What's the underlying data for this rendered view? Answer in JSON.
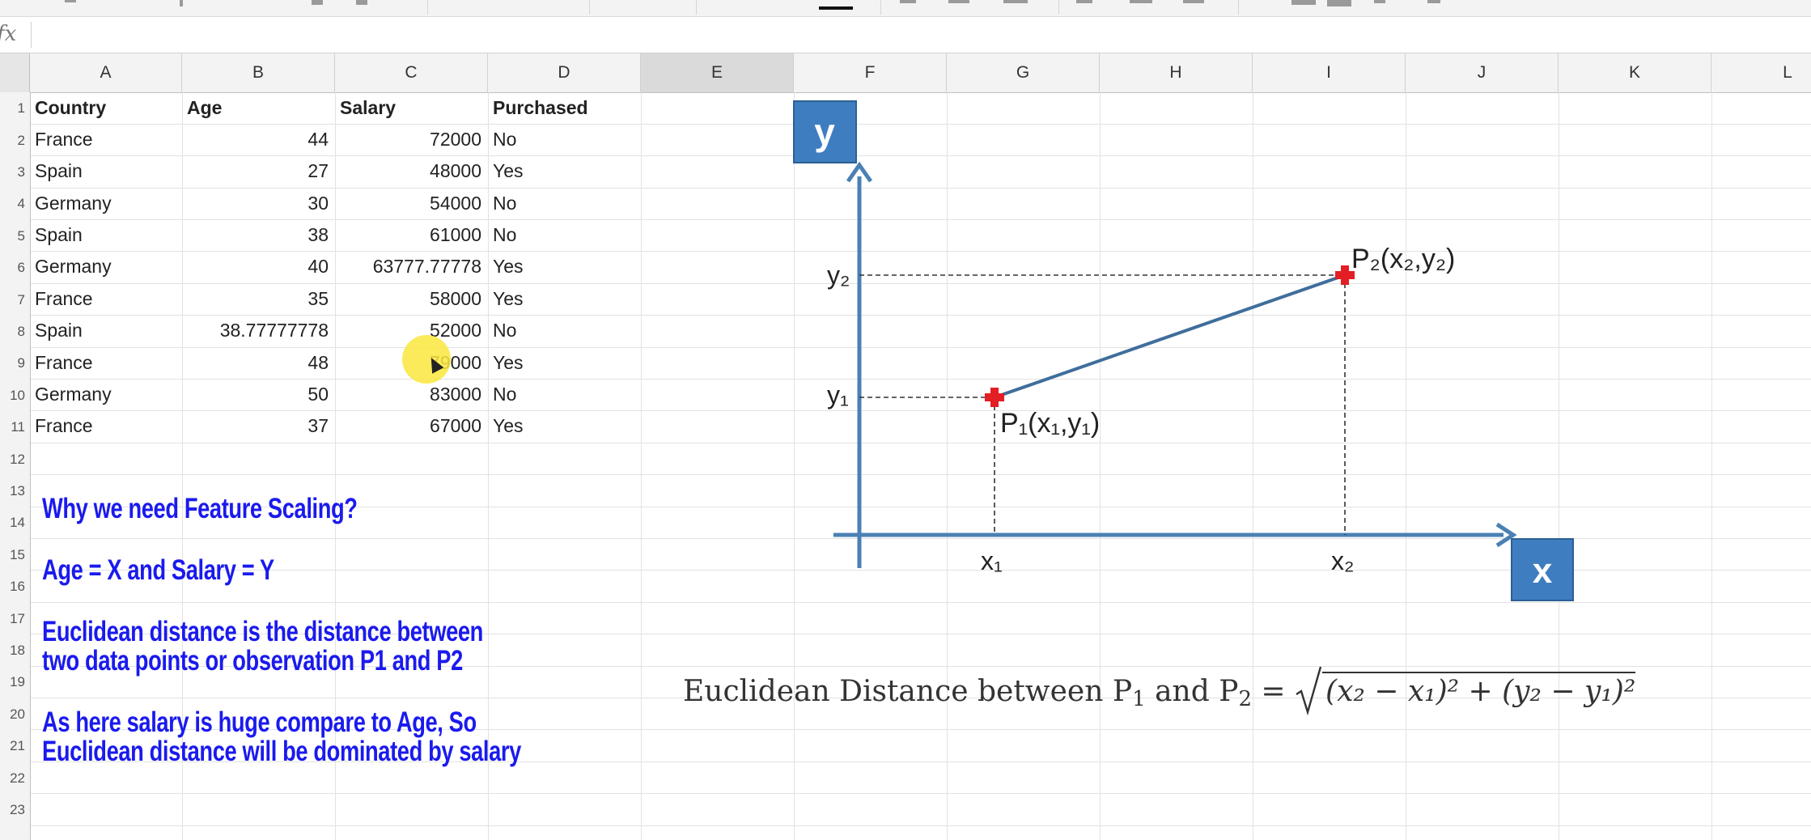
{
  "formula_bar": {
    "fx_label": "fx"
  },
  "columns": [
    "A",
    "B",
    "C",
    "D",
    "E",
    "F",
    "G",
    "H",
    "I",
    "J",
    "K",
    "L"
  ],
  "row_numbers": [
    "1",
    "2",
    "3",
    "4",
    "5",
    "6",
    "7",
    "8",
    "9",
    "10",
    "11",
    "12",
    "13",
    "14",
    "15",
    "16",
    "17",
    "18",
    "19",
    "20",
    "21",
    "22",
    "23"
  ],
  "table": {
    "headers": [
      "Country",
      "Age",
      "Salary",
      "Purchased"
    ],
    "rows": [
      [
        "France",
        "44",
        "72000",
        "No"
      ],
      [
        "Spain",
        "27",
        "48000",
        "Yes"
      ],
      [
        "Germany",
        "30",
        "54000",
        "No"
      ],
      [
        "Spain",
        "38",
        "61000",
        "No"
      ],
      [
        "Germany",
        "40",
        "63777.77778",
        "Yes"
      ],
      [
        "France",
        "35",
        "58000",
        "Yes"
      ],
      [
        "Spain",
        "38.77777778",
        "52000",
        "No"
      ],
      [
        "France",
        "48",
        "79000",
        "Yes"
      ],
      [
        "Germany",
        "50",
        "83000",
        "No"
      ],
      [
        "France",
        "37",
        "67000",
        "Yes"
      ]
    ]
  },
  "notes": [
    "Why we need Feature Scaling?",
    "Age = X  and Salary = Y",
    "Euclidean distance is the distance between",
    " two data points or observation P1 and P2",
    "As here salary is huge compare to Age, So",
    "Euclidean distance will be dominated by  salary"
  ],
  "diagram": {
    "y_axis_label": "y",
    "x_axis_label": "x",
    "y2_label": "y₂",
    "y1_label": "y₁",
    "x1_label": "x₁",
    "x2_label": "x₂",
    "p2_label": "P₂(x₂,y₂)",
    "p1_label": "P₁(x₁,y₁)",
    "axis_color": "#4a80b4",
    "box_color": "#3e7dc0",
    "point_color": "#e31e24"
  },
  "formula": {
    "prefix": "Euclidean Distance between P",
    "p1_sub": "1",
    "mid": " and P",
    "p2_sub": "2",
    "equals": " = ",
    "radicand": "(x₂ − x₁)² + (y₂ − y₁)²"
  },
  "colors": {
    "note_text": "#1a1aee",
    "selected_column_header": "#dadada",
    "cursor_highlight": "#f8e03c"
  }
}
